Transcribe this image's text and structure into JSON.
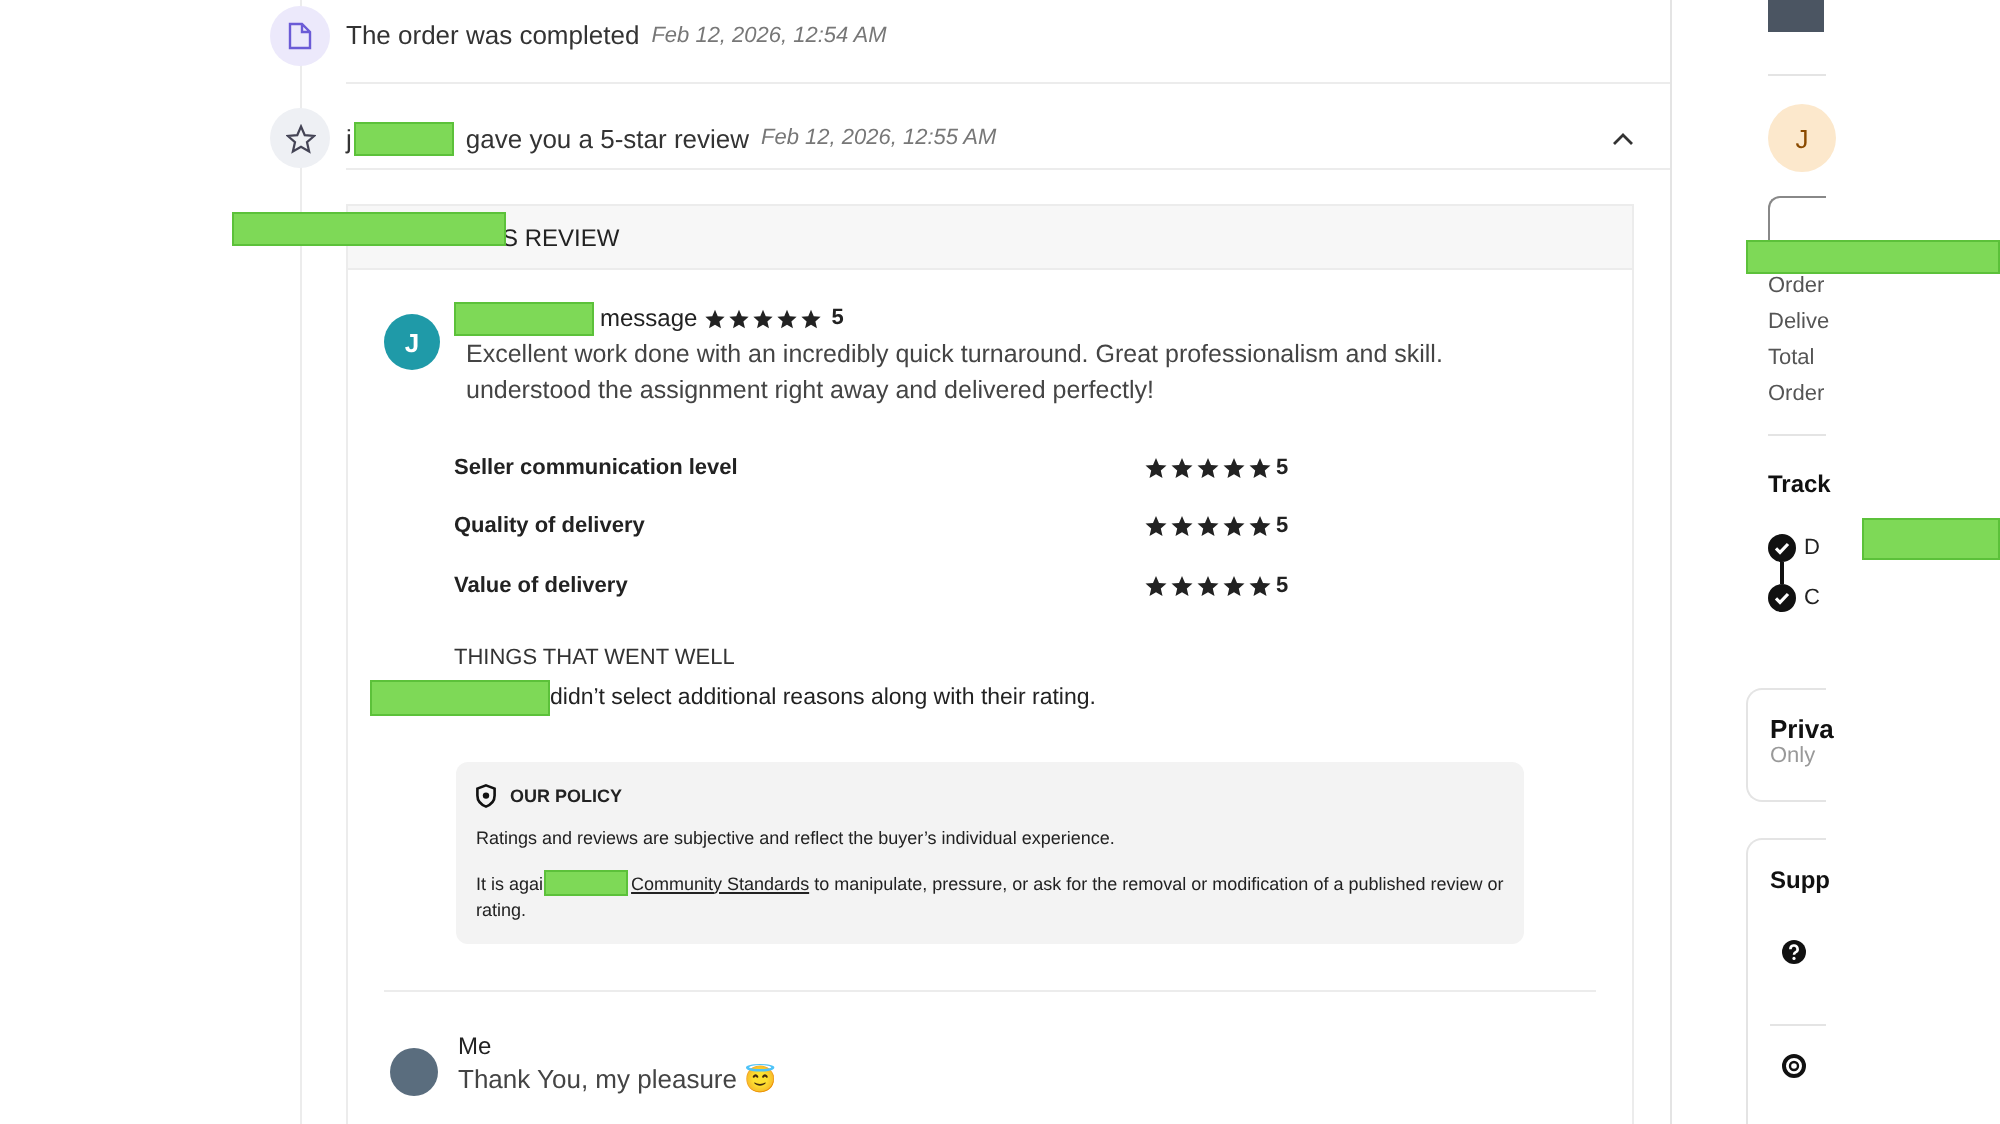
{
  "timeline": [
    {
      "kind": "completed",
      "text": "The order was completed",
      "time": "Feb 12, 2026, 12:54 AM"
    },
    {
      "kind": "review",
      "prefix": "j",
      "text": "gave you a 5-star review",
      "time": "Feb 12, 2026, 12:55 AM",
      "expanded": true
    }
  ],
  "review": {
    "header": "S REVIEW",
    "avatar_initial": "J",
    "author_suffix": "message",
    "stars": 5,
    "score": "5",
    "text": "Excellent work done with an incredibly quick turnaround. Great professionalism and skill. understood the assignment right away and delivered perfectly!",
    "ratings": [
      {
        "label": "Seller communication level",
        "stars": 5,
        "score": "5"
      },
      {
        "label": "Quality of delivery",
        "stars": 5,
        "score": "5"
      },
      {
        "label": "Value of delivery",
        "stars": 5,
        "score": "5"
      }
    ],
    "things_heading": "THINGS THAT WENT WELL",
    "things_text": "didn’t select additional reasons along with their rating.",
    "policy": {
      "title": "OUR POLICY",
      "text": "Ratings and reviews are subjective and reflect the buyer’s individual experience.",
      "rule_prefix": "It is agai",
      "rule_link": "Community Standards",
      "rule_rest": " to manipulate, pressure, or ask for the removal or modification of a published review or rating."
    }
  },
  "reply": {
    "author": "Me",
    "text": "Thank You, my pleasure 😇"
  },
  "sidebar": {
    "avatar_initial": "J",
    "order_details": [
      "Order",
      "Delive",
      "Total",
      "Order"
    ],
    "tracking": {
      "title": "Track",
      "steps": [
        {
          "label": "D",
          "done": true
        },
        {
          "label": "C",
          "done": true
        }
      ]
    },
    "privacy": {
      "title": "Priva",
      "text": "Only"
    },
    "support": {
      "title": "Supp"
    }
  }
}
